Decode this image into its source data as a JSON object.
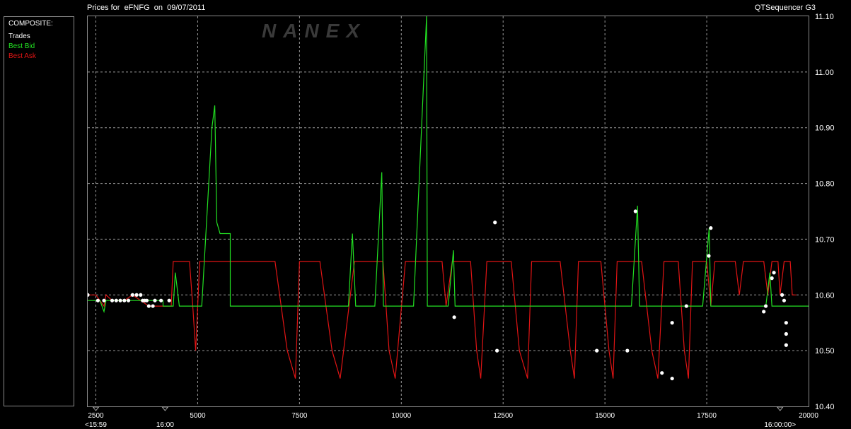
{
  "header": {
    "title": "Prices for  eFNFG  on  09/07/2011",
    "app": "QTSequencer G3",
    "watermark": "NANEX"
  },
  "legend": {
    "heading": "COMPOSITE:",
    "items": [
      {
        "label": "Trades",
        "color": "#ffffff"
      },
      {
        "label": "Best Bid",
        "color": "#22e022"
      },
      {
        "label": "Best Ask",
        "color": "#e01414"
      }
    ]
  },
  "chart_data": {
    "type": "line",
    "title": "Prices for  eFNFG  on  09/07/2011",
    "xlim": [
      2300,
      20000
    ],
    "ylim": [
      10.4,
      11.1
    ],
    "x_ticks": [
      2500,
      5000,
      7500,
      10000,
      12500,
      15000,
      17500,
      20000
    ],
    "x_tick_labels": [
      "2500",
      "5000",
      "7500",
      "10000",
      "12500",
      "15000",
      "17500",
      "20000"
    ],
    "x_time_labels": [
      {
        "x": 2500,
        "label": "<15:59"
      },
      {
        "x": 4200,
        "label": "16:00"
      },
      {
        "x": 19300,
        "label": "16:00:00>"
      }
    ],
    "y_ticks": [
      10.4,
      10.5,
      10.6,
      10.7,
      10.8,
      10.9,
      11.0,
      11.1
    ],
    "y_tick_labels": [
      "10.40",
      "10.50",
      "10.60",
      "10.70",
      "10.80",
      "10.90",
      "11.00",
      "11.10"
    ],
    "grid": true,
    "legend_position": "left-panel",
    "series": [
      {
        "name": "Best Ask",
        "color": "#e01414",
        "points": [
          [
            2300,
            10.6
          ],
          [
            2500,
            10.6
          ],
          [
            2600,
            10.59
          ],
          [
            2700,
            10.58
          ],
          [
            2750,
            10.6
          ],
          [
            2900,
            10.59
          ],
          [
            3200,
            10.59
          ],
          [
            3400,
            10.6
          ],
          [
            3800,
            10.58
          ],
          [
            4100,
            10.58
          ],
          [
            4350,
            10.58
          ],
          [
            4400,
            10.66
          ],
          [
            4800,
            10.66
          ],
          [
            4880,
            10.58
          ],
          [
            4950,
            10.5
          ],
          [
            5050,
            10.66
          ],
          [
            6900,
            10.66
          ],
          [
            7200,
            10.5
          ],
          [
            7400,
            10.45
          ],
          [
            7500,
            10.66
          ],
          [
            8000,
            10.66
          ],
          [
            8300,
            10.5
          ],
          [
            8500,
            10.45
          ],
          [
            8850,
            10.66
          ],
          [
            9550,
            10.66
          ],
          [
            9700,
            10.5
          ],
          [
            9850,
            10.45
          ],
          [
            10100,
            10.66
          ],
          [
            11000,
            10.66
          ],
          [
            11100,
            10.58
          ],
          [
            11250,
            10.66
          ],
          [
            11700,
            10.66
          ],
          [
            11850,
            10.5
          ],
          [
            11950,
            10.45
          ],
          [
            12100,
            10.66
          ],
          [
            12700,
            10.66
          ],
          [
            12900,
            10.5
          ],
          [
            13100,
            10.45
          ],
          [
            13200,
            10.66
          ],
          [
            13900,
            10.66
          ],
          [
            14150,
            10.5
          ],
          [
            14250,
            10.45
          ],
          [
            14350,
            10.66
          ],
          [
            14900,
            10.66
          ],
          [
            15100,
            10.5
          ],
          [
            15200,
            10.45
          ],
          [
            15300,
            10.66
          ],
          [
            15900,
            10.66
          ],
          [
            16150,
            10.5
          ],
          [
            16300,
            10.45
          ],
          [
            16450,
            10.66
          ],
          [
            16800,
            10.66
          ],
          [
            16950,
            10.5
          ],
          [
            17050,
            10.45
          ],
          [
            17150,
            10.66
          ],
          [
            17500,
            10.66
          ],
          [
            17600,
            10.58
          ],
          [
            17700,
            10.66
          ],
          [
            18200,
            10.66
          ],
          [
            18300,
            10.6
          ],
          [
            18400,
            10.66
          ],
          [
            18900,
            10.66
          ],
          [
            19000,
            10.6
          ],
          [
            19100,
            10.66
          ],
          [
            19250,
            10.66
          ],
          [
            19300,
            10.6
          ],
          [
            19400,
            10.66
          ],
          [
            19550,
            10.66
          ],
          [
            19600,
            10.6
          ],
          [
            19700,
            10.6
          ]
        ]
      },
      {
        "name": "Best Bid",
        "color": "#22e022",
        "points": [
          [
            2300,
            10.59
          ],
          [
            2600,
            10.59
          ],
          [
            2700,
            10.57
          ],
          [
            2750,
            10.59
          ],
          [
            4150,
            10.59
          ],
          [
            4150,
            10.58
          ],
          [
            4400,
            10.58
          ],
          [
            4450,
            10.64
          ],
          [
            4550,
            10.58
          ],
          [
            5100,
            10.58
          ],
          [
            5350,
            10.9
          ],
          [
            5420,
            10.94
          ],
          [
            5470,
            10.73
          ],
          [
            5550,
            10.71
          ],
          [
            5800,
            10.71
          ],
          [
            5800,
            10.58
          ],
          [
            8700,
            10.58
          ],
          [
            8800,
            10.71
          ],
          [
            8880,
            10.58
          ],
          [
            9350,
            10.58
          ],
          [
            9520,
            10.82
          ],
          [
            9560,
            10.58
          ],
          [
            10300,
            10.58
          ],
          [
            10620,
            11.1
          ],
          [
            10640,
            10.58
          ],
          [
            11150,
            10.58
          ],
          [
            11280,
            10.68
          ],
          [
            11320,
            10.58
          ],
          [
            15650,
            10.58
          ],
          [
            15800,
            10.76
          ],
          [
            15850,
            10.58
          ],
          [
            17400,
            10.58
          ],
          [
            17560,
            10.72
          ],
          [
            17600,
            10.58
          ],
          [
            18800,
            10.58
          ],
          [
            18950,
            10.58
          ],
          [
            19050,
            10.64
          ],
          [
            19100,
            10.58
          ],
          [
            20000,
            10.58
          ]
        ]
      },
      {
        "name": "Trades",
        "color": "#ffffff",
        "points": [
          [
            2300,
            10.6
          ],
          [
            2550,
            10.59
          ],
          [
            2700,
            10.59
          ],
          [
            2900,
            10.59
          ],
          [
            3000,
            10.59
          ],
          [
            3100,
            10.59
          ],
          [
            3200,
            10.59
          ],
          [
            3300,
            10.59
          ],
          [
            3400,
            10.6
          ],
          [
            3500,
            10.6
          ],
          [
            3600,
            10.6
          ],
          [
            3650,
            10.59
          ],
          [
            3700,
            10.59
          ],
          [
            3750,
            10.59
          ],
          [
            3800,
            10.58
          ],
          [
            3900,
            10.58
          ],
          [
            3950,
            10.59
          ],
          [
            4100,
            10.59
          ],
          [
            4300,
            10.59
          ],
          [
            11300,
            10.56
          ],
          [
            12300,
            10.73
          ],
          [
            12350,
            10.5
          ],
          [
            14800,
            10.5
          ],
          [
            15550,
            10.5
          ],
          [
            15750,
            10.75
          ],
          [
            16400,
            10.46
          ],
          [
            16650,
            10.45
          ],
          [
            16650,
            10.55
          ],
          [
            17000,
            10.58
          ],
          [
            17550,
            10.67
          ],
          [
            17600,
            10.72
          ],
          [
            18900,
            10.57
          ],
          [
            18950,
            10.58
          ],
          [
            19100,
            10.63
          ],
          [
            19150,
            10.64
          ],
          [
            19350,
            10.6
          ],
          [
            19400,
            10.59
          ],
          [
            19450,
            10.55
          ],
          [
            19450,
            10.53
          ],
          [
            19450,
            10.51
          ]
        ]
      }
    ]
  }
}
